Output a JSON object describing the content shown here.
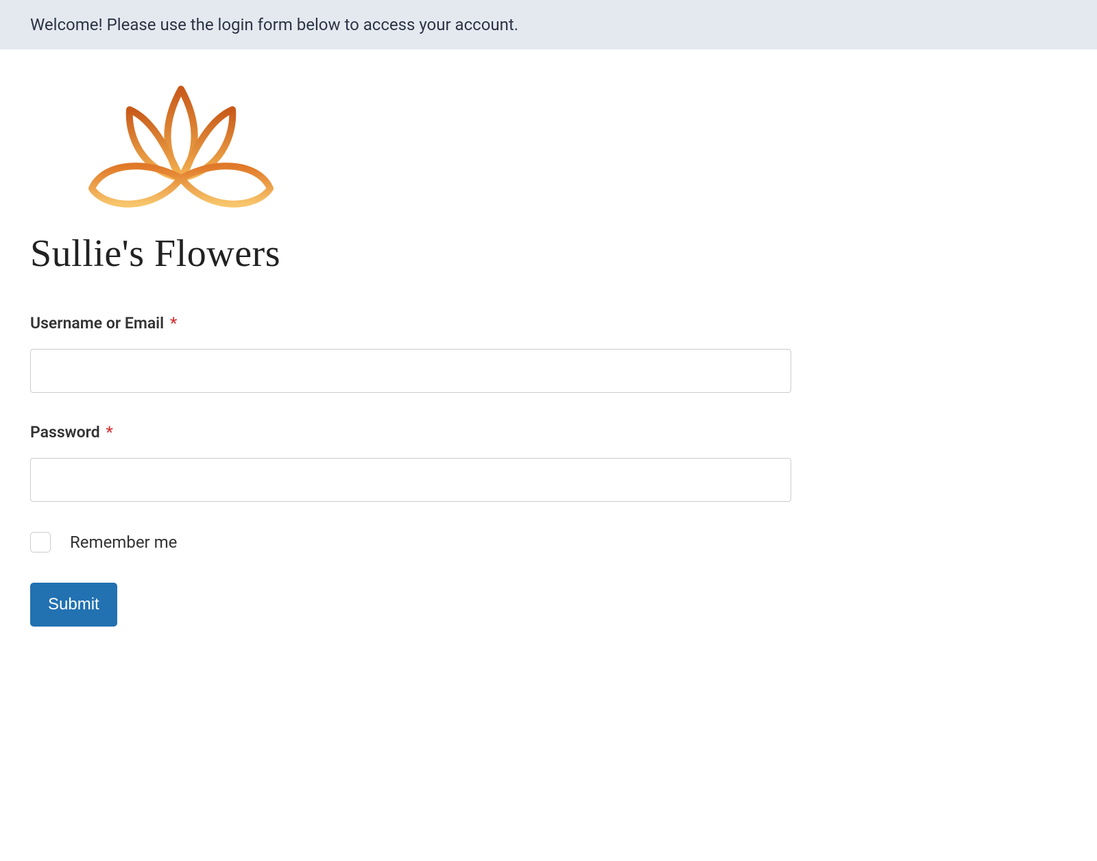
{
  "banner": {
    "message": "Welcome! Please use the login form below to access your account."
  },
  "brand": {
    "name": "Sullie's Flowers",
    "icon": "lotus-icon"
  },
  "form": {
    "username": {
      "label": "Username or Email",
      "required_marker": "*",
      "value": ""
    },
    "password": {
      "label": "Password",
      "required_marker": "*",
      "value": ""
    },
    "remember": {
      "label": "Remember me",
      "checked": false
    },
    "submit": {
      "label": "Submit"
    }
  },
  "colors": {
    "banner_bg": "#e3e9ef",
    "primary": "#2271b1",
    "required": "#d63638",
    "logo_dark": "#c85a1a",
    "logo_light": "#f5a83c"
  }
}
